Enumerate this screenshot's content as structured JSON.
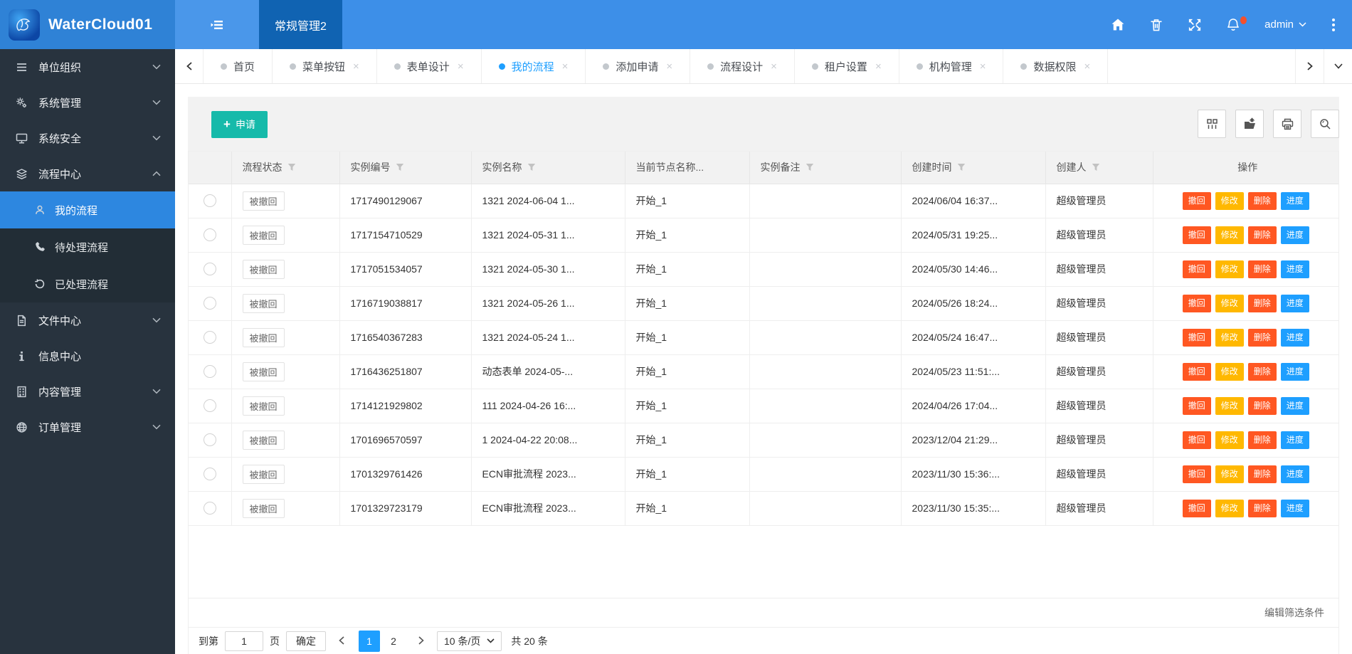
{
  "app": {
    "title": "WaterCloud01"
  },
  "topbar": {
    "workspace_tab": "常规管理2",
    "username": "admin",
    "icons": [
      "home-icon",
      "trash-icon",
      "fullscreen-icon",
      "bell-icon"
    ]
  },
  "sidebar": {
    "items": [
      {
        "label": "单位组织",
        "icon": "org-icon",
        "chevron": "down",
        "expanded": false,
        "children": []
      },
      {
        "label": "系统管理",
        "icon": "gear-icon",
        "chevron": "down",
        "expanded": false,
        "children": []
      },
      {
        "label": "系统安全",
        "icon": "monitor-icon",
        "chevron": "down",
        "expanded": false,
        "children": []
      },
      {
        "label": "流程中心",
        "icon": "process-icon",
        "chevron": "up",
        "expanded": true,
        "children": [
          {
            "label": "我的流程",
            "icon": "user-icon",
            "active": true
          },
          {
            "label": "待处理流程",
            "icon": "phone-icon",
            "active": false
          },
          {
            "label": "已处理流程",
            "icon": "history-icon",
            "active": false
          }
        ]
      },
      {
        "label": "文件中心",
        "icon": "file-icon",
        "chevron": "down",
        "expanded": false,
        "children": []
      },
      {
        "label": "信息中心",
        "icon": "info-icon",
        "chevron": "",
        "expanded": false,
        "children": []
      },
      {
        "label": "内容管理",
        "icon": "content-icon",
        "chevron": "down",
        "expanded": false,
        "children": []
      },
      {
        "label": "订单管理",
        "icon": "order-icon",
        "chevron": "down",
        "expanded": false,
        "children": []
      }
    ]
  },
  "tabbar": {
    "tabs": [
      {
        "label": "首页",
        "closable": false,
        "active": false
      },
      {
        "label": "菜单按钮",
        "closable": true,
        "active": false
      },
      {
        "label": "表单设计",
        "closable": true,
        "active": false
      },
      {
        "label": "我的流程",
        "closable": true,
        "active": true
      },
      {
        "label": "添加申请",
        "closable": true,
        "active": false
      },
      {
        "label": "流程设计",
        "closable": true,
        "active": false
      },
      {
        "label": "租户设置",
        "closable": true,
        "active": false
      },
      {
        "label": "机构管理",
        "closable": true,
        "active": false
      },
      {
        "label": "数据权限",
        "closable": true,
        "active": false
      }
    ]
  },
  "toolbar": {
    "apply_label": "申请",
    "tool_icons": [
      "columns-icon",
      "export-icon",
      "print-icon",
      "search-icon"
    ]
  },
  "table": {
    "columns": [
      {
        "label": "",
        "filter": false
      },
      {
        "label": "流程状态",
        "filter": true
      },
      {
        "label": "实例编号",
        "filter": true
      },
      {
        "label": "实例名称",
        "filter": true
      },
      {
        "label": "当前节点名称...",
        "filter": false
      },
      {
        "label": "实例备注",
        "filter": true
      },
      {
        "label": "创建时间",
        "filter": true
      },
      {
        "label": "创建人",
        "filter": true
      },
      {
        "label": "操作",
        "filter": false
      }
    ],
    "action_labels": [
      "撤回",
      "修改",
      "删除",
      "进度"
    ],
    "rows": [
      {
        "status": "被撤回",
        "instance_id": "1717490129067",
        "instance_name": "1321 2024-06-04 1...",
        "current_node": "开始_1",
        "remark": "",
        "created_at": "2024/06/04 16:37...",
        "creator": "超级管理员"
      },
      {
        "status": "被撤回",
        "instance_id": "1717154710529",
        "instance_name": "1321 2024-05-31 1...",
        "current_node": "开始_1",
        "remark": "",
        "created_at": "2024/05/31 19:25...",
        "creator": "超级管理员"
      },
      {
        "status": "被撤回",
        "instance_id": "1717051534057",
        "instance_name": "1321 2024-05-30 1...",
        "current_node": "开始_1",
        "remark": "",
        "created_at": "2024/05/30 14:46...",
        "creator": "超级管理员"
      },
      {
        "status": "被撤回",
        "instance_id": "1716719038817",
        "instance_name": "1321 2024-05-26 1...",
        "current_node": "开始_1",
        "remark": "",
        "created_at": "2024/05/26 18:24...",
        "creator": "超级管理员"
      },
      {
        "status": "被撤回",
        "instance_id": "1716540367283",
        "instance_name": "1321 2024-05-24 1...",
        "current_node": "开始_1",
        "remark": "",
        "created_at": "2024/05/24 16:47...",
        "creator": "超级管理员"
      },
      {
        "status": "被撤回",
        "instance_id": "1716436251807",
        "instance_name": "动态表单 2024-05-...",
        "current_node": "开始_1",
        "remark": "",
        "created_at": "2024/05/23 11:51:...",
        "creator": "超级管理员"
      },
      {
        "status": "被撤回",
        "instance_id": "1714121929802",
        "instance_name": "111 2024-04-26 16:...",
        "current_node": "开始_1",
        "remark": "",
        "created_at": "2024/04/26 17:04...",
        "creator": "超级管理员"
      },
      {
        "status": "被撤回",
        "instance_id": "1701696570597",
        "instance_name": "1 2024-04-22 20:08...",
        "current_node": "开始_1",
        "remark": "",
        "created_at": "2023/12/04 21:29...",
        "creator": "超级管理员"
      },
      {
        "status": "被撤回",
        "instance_id": "1701329761426",
        "instance_name": "ECN审批流程 2023...",
        "current_node": "开始_1",
        "remark": "",
        "created_at": "2023/11/30 15:36:...",
        "creator": "超级管理员"
      },
      {
        "status": "被撤回",
        "instance_id": "1701329723179",
        "instance_name": "ECN审批流程 2023...",
        "current_node": "开始_1",
        "remark": "",
        "created_at": "2023/11/30 15:35:...",
        "creator": "超级管理员"
      }
    ]
  },
  "footer": {
    "filter_edit_label": "编辑筛选条件",
    "pagination": {
      "goto_prefix": "到第",
      "goto_value": "1",
      "goto_suffix": "页",
      "confirm_label": "确定",
      "pages": [
        "1",
        "2"
      ],
      "active_page": "1",
      "page_size_label": "10 条/页",
      "total_label": "共 20 条"
    }
  },
  "colors": {
    "header_blue": "#3d8fe8",
    "brand_blue": "#2f82d6",
    "active_top_tab_blue": "#1063b2",
    "sidebar_dark": "#28333e",
    "submenu_dark": "#222d36",
    "active_item_blue": "#2d87e0",
    "accent_blue": "#1e9fff",
    "apply_teal": "#16baaa",
    "danger_orange": "#ff5722",
    "warning_amber": "#ffb800",
    "notification_red": "#f4502c"
  }
}
